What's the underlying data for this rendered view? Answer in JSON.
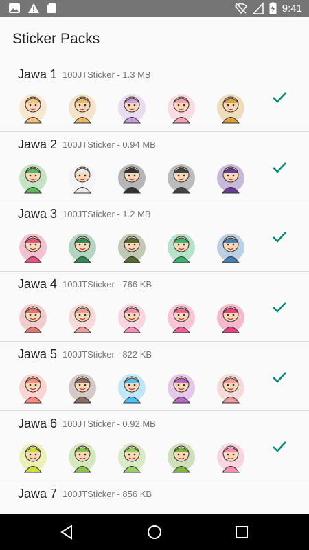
{
  "status_bar": {
    "time": "9:41",
    "icons": [
      "image-icon",
      "warning-icon",
      "sd-card-icon",
      "wifi-off-icon",
      "signal-icon",
      "battery-charging-icon"
    ]
  },
  "app_bar": {
    "title": "Sticker Packs"
  },
  "packs": [
    {
      "name": "Jawa 1",
      "meta": "100JTSticker - 1.3 MB",
      "added": true,
      "sticker_colors": [
        "#f1c27d",
        "#e8b86b",
        "#c9a0dc",
        "#f4a3b5",
        "#d9a441"
      ]
    },
    {
      "name": "Jawa 2",
      "meta": "100JTSticker - 0.94 MB",
      "added": true,
      "sticker_colors": [
        "#5cb85c",
        "#e8e8e8",
        "#333333",
        "#444444",
        "#6a3d9a"
      ]
    },
    {
      "name": "Jawa 3",
      "meta": "100JTSticker - 1.2 MB",
      "added": true,
      "sticker_colors": [
        "#e75480",
        "#2e8b57",
        "#556b2f",
        "#3cb371",
        "#4682b4"
      ]
    },
    {
      "name": "Jawa 4",
      "meta": "100JTSticker - 766 KB",
      "added": true,
      "sticker_colors": [
        "#e57373",
        "#ef9a9a",
        "#f48fb1",
        "#f06292",
        "#ec407a"
      ]
    },
    {
      "name": "Jawa 5",
      "meta": "100JTSticker - 822 KB",
      "added": true,
      "sticker_colors": [
        "#ff8a80",
        "#8d6e63",
        "#4fc3f7",
        "#ba68c8",
        "#ef9a9a"
      ]
    },
    {
      "name": "Jawa 6",
      "meta": "100JTSticker - 0.92 MB",
      "added": true,
      "sticker_colors": [
        "#cddc39",
        "#8bc34a",
        "#9ccc65",
        "#7cb342",
        "#f48fb1"
      ]
    },
    {
      "name": "Jawa 7",
      "meta": "100JTSticker - 856 KB",
      "added": false,
      "sticker_colors": []
    }
  ],
  "accent_color": "#00897b",
  "nav_bar": {
    "icons": [
      "back-icon",
      "home-icon",
      "recents-icon"
    ]
  }
}
